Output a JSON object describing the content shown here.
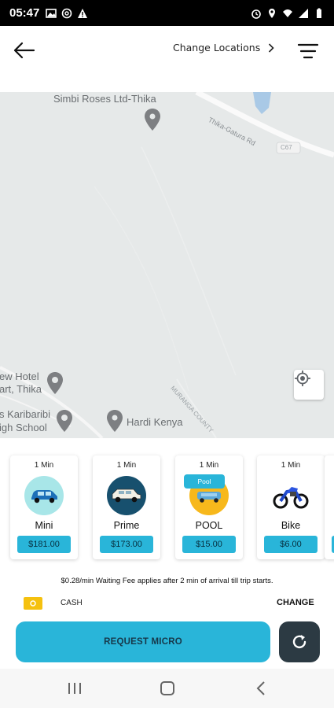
{
  "status_bar": {
    "time": "05:47",
    "icons": [
      "image-icon",
      "at-sign-icon",
      "warning-icon",
      "alarm-icon",
      "location-icon",
      "wifi-icon",
      "signal-icon",
      "battery-icon"
    ]
  },
  "header": {
    "change_locations": "Change Locations"
  },
  "map": {
    "places": {
      "simbi": "Simbi Roses Ltd-Thika",
      "hotel_line1": "ew Hotel",
      "hotel_line2": "art, Thika",
      "school_line1": "s Karibaribi",
      "school_line2": "igh School",
      "hardi": "Hardi Kenya"
    },
    "roads": {
      "thika_gatura": "Thika-Gatura Rd",
      "c67": "C67",
      "muranga": "MURANGA COUNTY"
    }
  },
  "vehicles": [
    {
      "eta": "1 Min",
      "name": "Mini",
      "price": "$181.00",
      "icon": "car-icon",
      "color": "#a8e6e8"
    },
    {
      "eta": "1 Min",
      "name": "Prime",
      "price": "$173.00",
      "icon": "suv-icon",
      "color": "#17506e"
    },
    {
      "eta": "1 Min",
      "name": "POOL",
      "price": "$15.00",
      "icon": "pool-car-icon",
      "color": "#f7b81c",
      "tag": "Pool"
    },
    {
      "eta": "1 Min",
      "name": "Bike",
      "price": "$6.00",
      "icon": "motorbike-icon",
      "color": "#ffffff"
    }
  ],
  "fee_note": "$0.28/min Waiting Fee applies after 2 min of arrival till trip starts.",
  "payment": {
    "method": "CASH",
    "change": "CHANGE"
  },
  "request_button": "REQUEST MICRO",
  "colors": {
    "accent": "#29b5d9",
    "dark_button": "#2c3a43",
    "cash": "#f5c10f"
  }
}
